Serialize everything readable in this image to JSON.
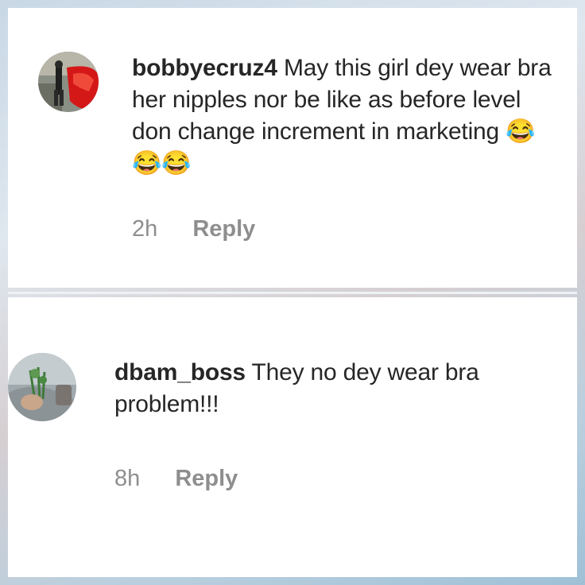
{
  "comments": [
    {
      "username": "bobbyecruz4",
      "text": "May this girl dey wear bra her nipples nor be like as before level don change increment in marketing 😂😂😂",
      "time": "2h",
      "reply_label": "Reply"
    },
    {
      "username": "dbam_boss",
      "text": "They no dey wear bra problem!!!",
      "time": "8h",
      "reply_label": "Reply"
    }
  ],
  "colors": {
    "text": "#262626",
    "meta": "#8e8e8e",
    "card": "#ffffff"
  }
}
